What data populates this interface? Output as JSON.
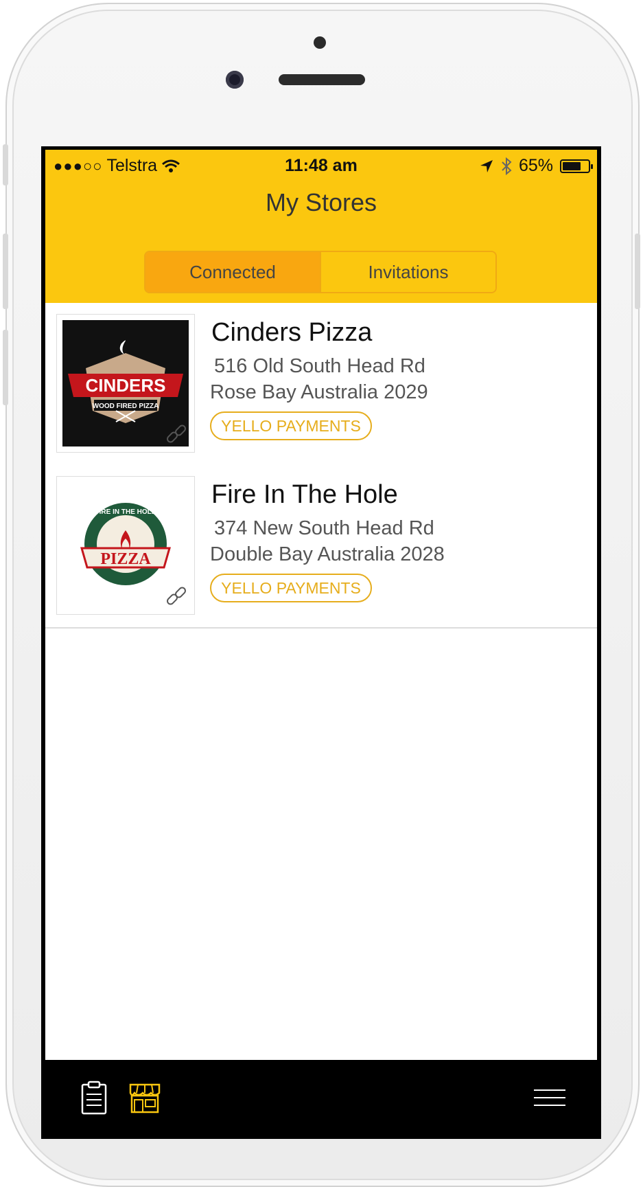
{
  "status_bar": {
    "signal": "●●●○○",
    "carrier": "Telstra",
    "time": "11:48 am",
    "battery": "65%",
    "battery_level": 0.65
  },
  "header": {
    "title": "My Stores",
    "tabs": [
      {
        "label": "Connected",
        "selected": true
      },
      {
        "label": "Invitations",
        "selected": false
      }
    ]
  },
  "stores": [
    {
      "name": "Cinders Pizza",
      "address_line1": "516 Old South Head Rd",
      "address_line2": "Rose Bay Australia 2029",
      "badge": "YELLO PAYMENTS",
      "logo": {
        "text": "CINDERS",
        "subtext": "WOOD FIRED PIZZA"
      }
    },
    {
      "name": "Fire In The Hole",
      "address_line1": "374 New South Head Rd",
      "address_line2": "Double Bay Australia 2028",
      "badge": "YELLO PAYMENTS",
      "logo": {
        "text": "PIZZA",
        "subtext": "FIRE IN THE HOLE"
      }
    }
  ],
  "tab_bar": {
    "items": [
      {
        "icon": "clipboard-icon",
        "active": false
      },
      {
        "icon": "store-icon",
        "active": true
      },
      {
        "icon": "menu-icon",
        "active": false
      }
    ]
  },
  "colors": {
    "accent": "#fbc70f",
    "accent_dark": "#f9a710",
    "badge": "#e6ad1c"
  }
}
